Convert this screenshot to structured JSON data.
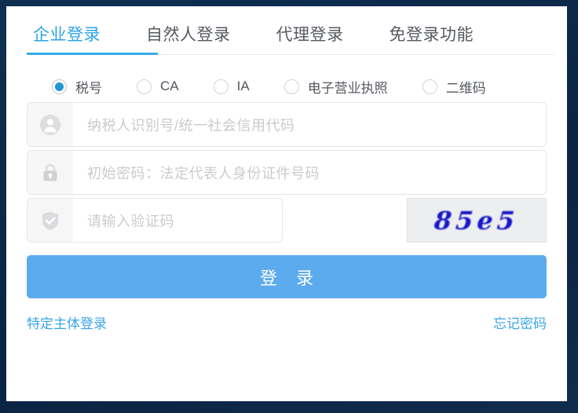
{
  "card": {
    "frame_color": "#0d2b4e",
    "background": "#ffffff"
  },
  "tabs": {
    "active_index": 0,
    "active_color": "#2aa3e8",
    "inactive_color": "#565a60",
    "items": [
      {
        "label": "企业登录",
        "active": true
      },
      {
        "label": "自然人登录",
        "active": false
      },
      {
        "label": "代理登录",
        "active": false
      },
      {
        "label": "免登录功能",
        "active": false
      }
    ]
  },
  "auth_methods": {
    "selected_index": 0,
    "selected_color": "#1e96d8",
    "options": [
      {
        "label": "税号",
        "selected": true
      },
      {
        "label": "CA",
        "selected": false
      },
      {
        "label": "IA",
        "selected": false
      },
      {
        "label": "电子营业执照",
        "selected": false
      },
      {
        "label": "二维码",
        "selected": false
      }
    ]
  },
  "form": {
    "username": {
      "icon": "user-icon",
      "value": "",
      "placeholder": "纳税人识别号/统一社会信用代码"
    },
    "password": {
      "icon": "lock-icon",
      "value": "",
      "placeholder": "初始密码：法定代表人身份证件号码"
    },
    "captcha": {
      "icon": "shield-check-icon",
      "value": "",
      "placeholder": "请输入验证码",
      "image_text": "85e5",
      "image_text_color": "#1616c8",
      "image_background": "#eceef0"
    },
    "submit": {
      "label": "登 录",
      "color": "#5cabee"
    }
  },
  "bottom_links": {
    "color": "#3aa5e8",
    "left": "特定主体登录",
    "right": "忘记密码"
  }
}
